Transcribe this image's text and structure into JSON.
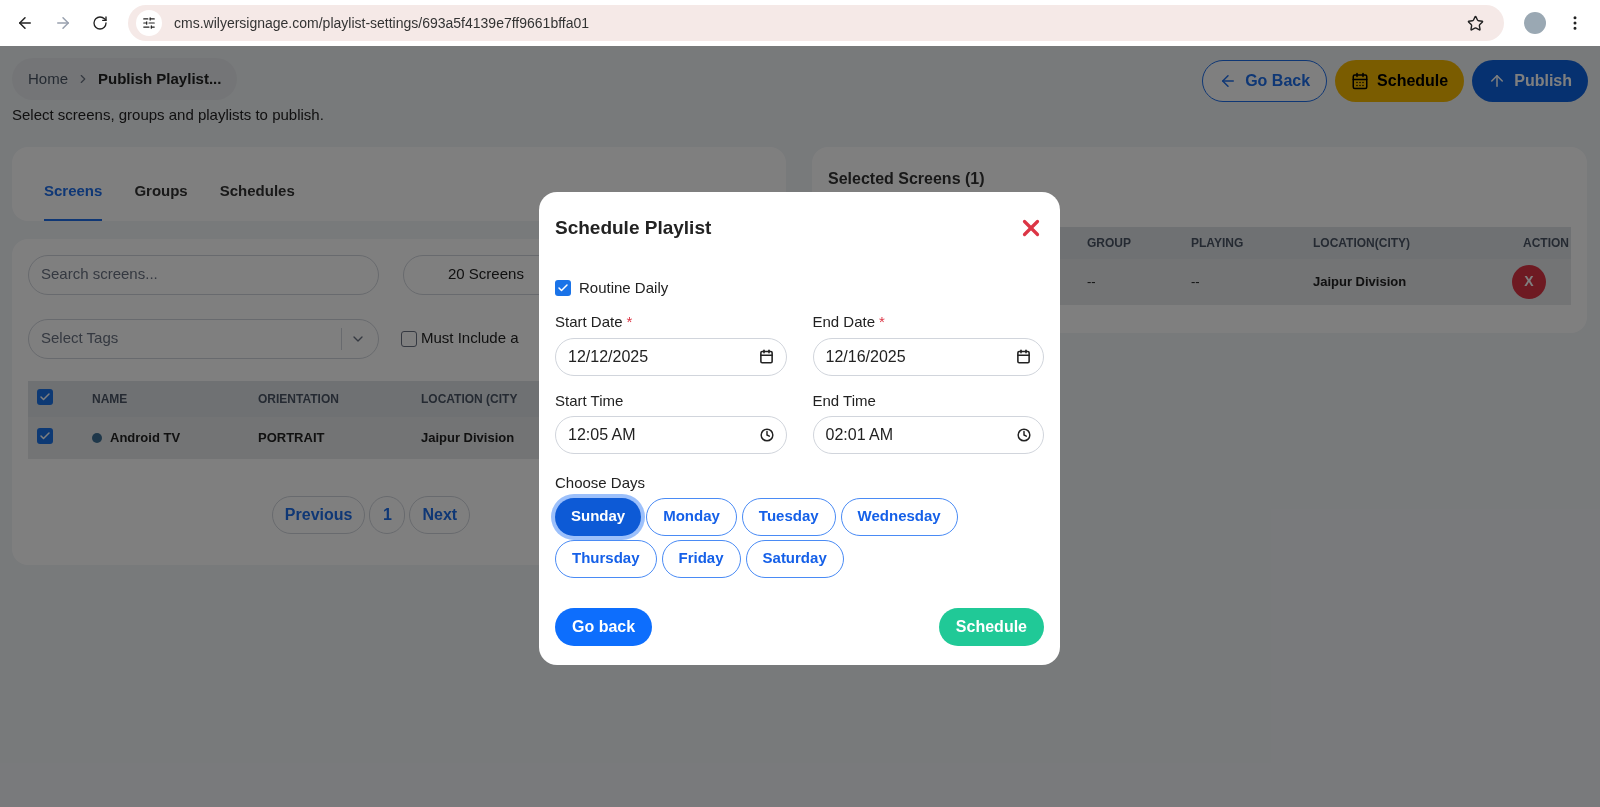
{
  "browser": {
    "url": "cms.wilyersignage.com/playlist-settings/693a5f4139e7ff9661bffa01"
  },
  "breadcrumb": [
    {
      "label": "Home"
    },
    {
      "label": "Publish Playlist..."
    }
  ],
  "actions": [
    {
      "label": "Go Back",
      "kind": "back"
    },
    {
      "label": "Schedule",
      "kind": "schedule"
    },
    {
      "label": "Publish",
      "kind": "publish"
    }
  ],
  "description": "Select screens, groups and playlists to publish.",
  "tabs": [
    {
      "label": "Screens",
      "selected": true
    },
    {
      "label": "Groups",
      "selected": false
    },
    {
      "label": "Schedules",
      "selected": false
    }
  ],
  "screens_panel": {
    "search": {
      "placeholder": "Search screens..."
    },
    "count_button": "20 Screens",
    "tags": {
      "placeholder": "Select Tags"
    },
    "must_include": {
      "label": "Must Include a",
      "checked": false
    },
    "table": {
      "header_checked": true,
      "columns": [
        "NAME",
        "ORIENTATION",
        "LOCATION (CITY"
      ],
      "rows": [
        {
          "checked": true,
          "name": "Android TV",
          "orientation": "PORTRAIT",
          "location": "Jaipur Division"
        }
      ]
    },
    "pagination": {
      "previous": "Previous",
      "page": "1",
      "next": "Next"
    }
  },
  "selected_panel": {
    "title": "Selected Screens (1)",
    "columns": [
      "GROUP",
      "PLAYING",
      "LOCATION(CITY)",
      "ACTION"
    ],
    "rows": [
      {
        "group": "--",
        "playing": "--",
        "location": "Jaipur Division",
        "action": "X"
      }
    ]
  },
  "modal": {
    "title": "Schedule Playlist",
    "routine_daily": {
      "label": "Routine Daily",
      "checked": true
    },
    "fields": [
      {
        "label": "Start Date",
        "required_mark": "*",
        "value": "12/12/2025",
        "kind": "date"
      },
      {
        "label": "End Date",
        "required_mark": "*",
        "value": "12/16/2025",
        "kind": "date"
      },
      {
        "label": "Start Time",
        "value": "12:05 AM",
        "kind": "time"
      },
      {
        "label": "End Time",
        "value": "02:01 AM",
        "kind": "time"
      }
    ],
    "days_label": "Choose Days",
    "days": [
      {
        "label": "Sunday",
        "selected": true
      },
      {
        "label": "Monday",
        "selected": false
      },
      {
        "label": "Tuesday",
        "selected": false
      },
      {
        "label": "Wednesday",
        "selected": false
      },
      {
        "label": "Thursday",
        "selected": false
      },
      {
        "label": "Friday",
        "selected": false
      },
      {
        "label": "Saturday",
        "selected": false
      }
    ],
    "buttons": [
      {
        "label": "Go back",
        "kind": "back"
      },
      {
        "label": "Schedule",
        "kind": "submit"
      }
    ]
  }
}
